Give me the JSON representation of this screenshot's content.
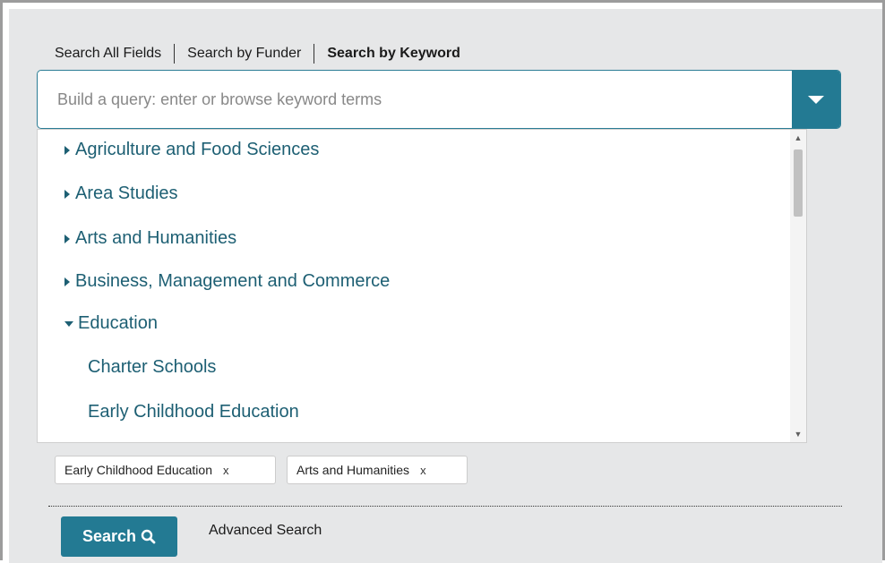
{
  "tabs": [
    {
      "label": "Search All Fields",
      "active": false
    },
    {
      "label": "Search by Funder",
      "active": false
    },
    {
      "label": "Search by Keyword",
      "active": true
    }
  ],
  "query": {
    "placeholder": "Build a query: enter or browse keyword terms",
    "value": ""
  },
  "dropdown_icon": "caret-down-icon",
  "keyword_tree": [
    {
      "label": "Agriculture and Food Sciences",
      "level": 0,
      "expanded": false
    },
    {
      "label": "Area Studies",
      "level": 0,
      "expanded": false
    },
    {
      "label": "Arts and Humanities",
      "level": 0,
      "expanded": false
    },
    {
      "label": "Business, Management and Commerce",
      "level": 0,
      "expanded": false
    },
    {
      "label": "Education",
      "level": 0,
      "expanded": true
    },
    {
      "label": "Charter Schools",
      "level": 1
    },
    {
      "label": "Early Childhood Education",
      "level": 1
    }
  ],
  "selected_terms": [
    {
      "label": "Early Childhood Education",
      "remove": "x"
    },
    {
      "label": "Arts and Humanities",
      "remove": "x"
    }
  ],
  "actions": {
    "search_label": "Search",
    "search_icon": "magnifier-icon",
    "advanced_label": "Advanced Search"
  },
  "colors": {
    "accent": "#237a93",
    "link": "#1d5f73",
    "panel_bg": "#e6e7e8"
  }
}
